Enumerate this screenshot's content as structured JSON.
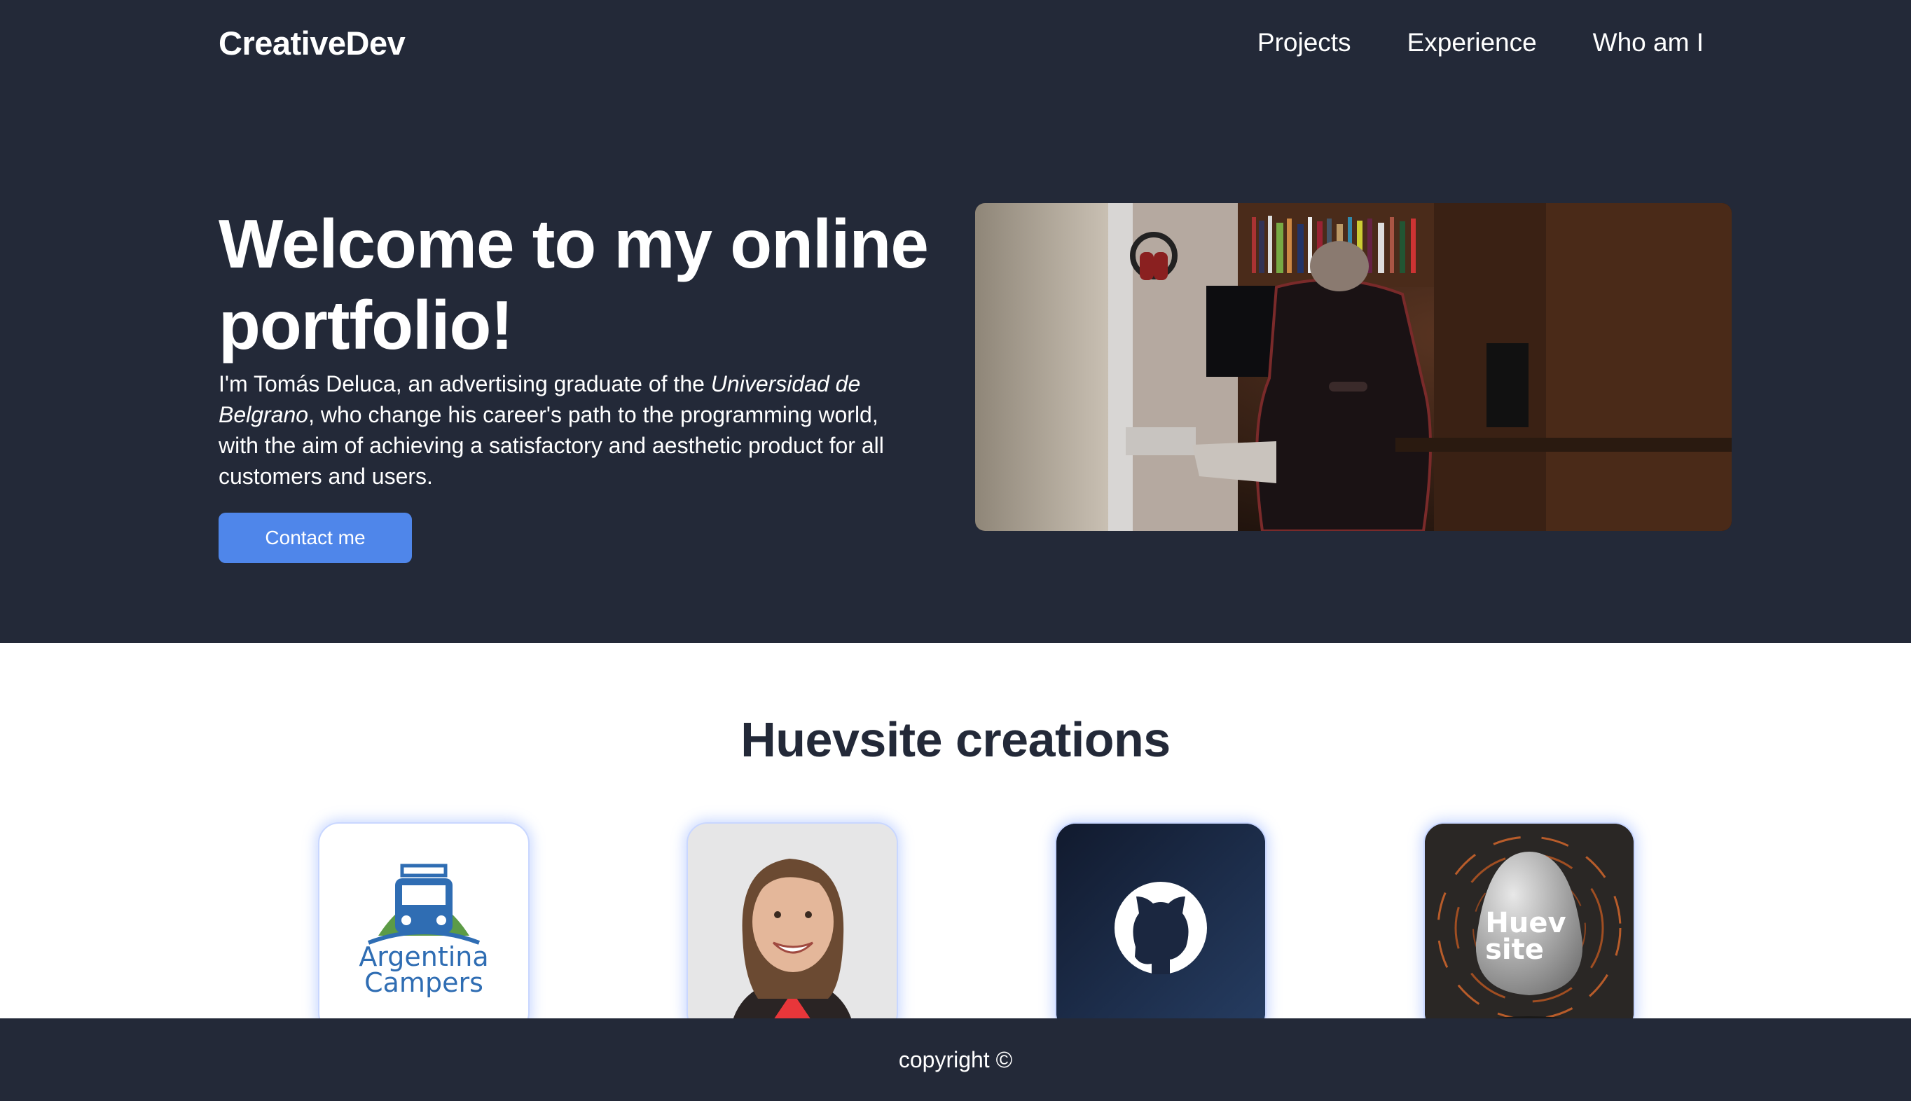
{
  "header": {
    "brand": "CreativeDev",
    "nav": [
      "Projects",
      "Experience",
      "Who am I"
    ]
  },
  "hero": {
    "title": "Welcome to my online portfolio!",
    "intro_start": "I'm Tomás Deluca, an advertising graduate of the ",
    "intro_em": "Universidad de Belgrano",
    "intro_end": ", who change his career's path to the programming world, with the aim of achieving a satisfactory and aesthetic product for all customers and users.",
    "cta": "Contact me"
  },
  "creations": {
    "title": "Huevsite creations",
    "cards": [
      {
        "name": "argentina-campers",
        "logo_text_1": "Argentina",
        "logo_text_2": "Campers"
      },
      {
        "name": "portrait"
      },
      {
        "name": "github"
      },
      {
        "name": "huevsite",
        "logo_text_1": "Huev",
        "logo_text_2": "site"
      }
    ]
  },
  "footer": {
    "text": "copyright ©"
  },
  "colors": {
    "dark_bg": "#232938",
    "accent": "#4f86ea",
    "white": "#ffffff"
  }
}
